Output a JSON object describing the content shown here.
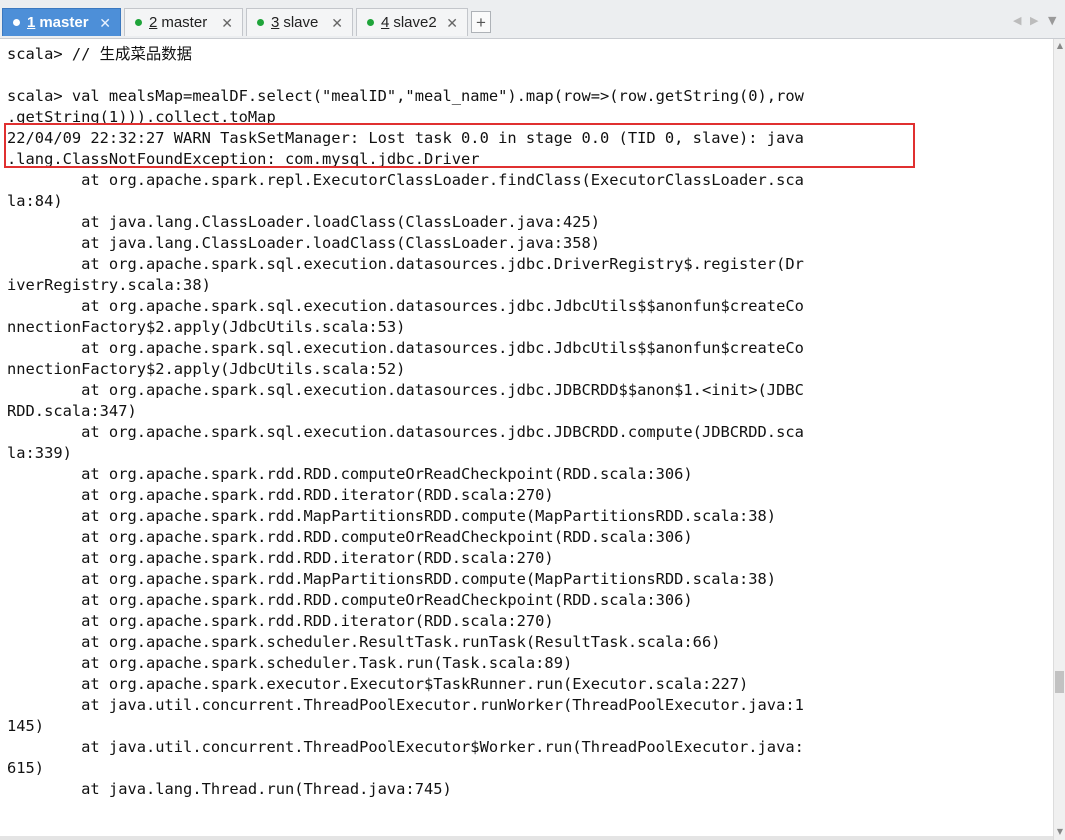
{
  "tabs": [
    {
      "number": "1",
      "label": "master",
      "active": true
    },
    {
      "number": "2",
      "label": "master",
      "active": false
    },
    {
      "number": "3",
      "label": "slave",
      "active": false
    },
    {
      "number": "4",
      "label": "slave2",
      "active": false
    }
  ],
  "tab_close_glyph": "✕",
  "new_tab_glyph": "+",
  "nav": {
    "prev": "◀",
    "next": "▶",
    "menu": "▼"
  },
  "colors": {
    "active_tab": "#4d8fd8",
    "status_dot": "#1fa43a",
    "highlight_border": "#e03030"
  },
  "terminal": {
    "lines": [
      "scala> // 生成菜品数据",
      "",
      "scala> val mealsMap=mealDF.select(\"mealID\",\"meal_name\").map(row=>(row.getString(0),row",
      ".getString(1))).collect.toMap",
      "22/04/09 22:32:27 WARN TaskSetManager: Lost task 0.0 in stage 0.0 (TID 0, slave): java",
      ".lang.ClassNotFoundException: com.mysql.jdbc.Driver",
      "        at org.apache.spark.repl.ExecutorClassLoader.findClass(ExecutorClassLoader.sca",
      "la:84)",
      "        at java.lang.ClassLoader.loadClass(ClassLoader.java:425)",
      "        at java.lang.ClassLoader.loadClass(ClassLoader.java:358)",
      "        at org.apache.spark.sql.execution.datasources.jdbc.DriverRegistry$.register(Dr",
      "iverRegistry.scala:38)",
      "        at org.apache.spark.sql.execution.datasources.jdbc.JdbcUtils$$anonfun$createCo",
      "nnectionFactory$2.apply(JdbcUtils.scala:53)",
      "        at org.apache.spark.sql.execution.datasources.jdbc.JdbcUtils$$anonfun$createCo",
      "nnectionFactory$2.apply(JdbcUtils.scala:52)",
      "        at org.apache.spark.sql.execution.datasources.jdbc.JDBCRDD$$anon$1.<init>(JDBC",
      "RDD.scala:347)",
      "        at org.apache.spark.sql.execution.datasources.jdbc.JDBCRDD.compute(JDBCRDD.sca",
      "la:339)",
      "        at org.apache.spark.rdd.RDD.computeOrReadCheckpoint(RDD.scala:306)",
      "        at org.apache.spark.rdd.RDD.iterator(RDD.scala:270)",
      "        at org.apache.spark.rdd.MapPartitionsRDD.compute(MapPartitionsRDD.scala:38)",
      "        at org.apache.spark.rdd.RDD.computeOrReadCheckpoint(RDD.scala:306)",
      "        at org.apache.spark.rdd.RDD.iterator(RDD.scala:270)",
      "        at org.apache.spark.rdd.MapPartitionsRDD.compute(MapPartitionsRDD.scala:38)",
      "        at org.apache.spark.rdd.RDD.computeOrReadCheckpoint(RDD.scala:306)",
      "        at org.apache.spark.rdd.RDD.iterator(RDD.scala:270)",
      "        at org.apache.spark.scheduler.ResultTask.runTask(ResultTask.scala:66)",
      "        at org.apache.spark.scheduler.Task.run(Task.scala:89)",
      "        at org.apache.spark.executor.Executor$TaskRunner.run(Executor.scala:227)",
      "        at java.util.concurrent.ThreadPoolExecutor.runWorker(ThreadPoolExecutor.java:1",
      "145)",
      "        at java.util.concurrent.ThreadPoolExecutor$Worker.run(ThreadPoolExecutor.java:",
      "615)",
      "        at java.lang.Thread.run(Thread.java:745)"
    ]
  },
  "scrollbar": {
    "up": "▲",
    "down": "▼"
  }
}
